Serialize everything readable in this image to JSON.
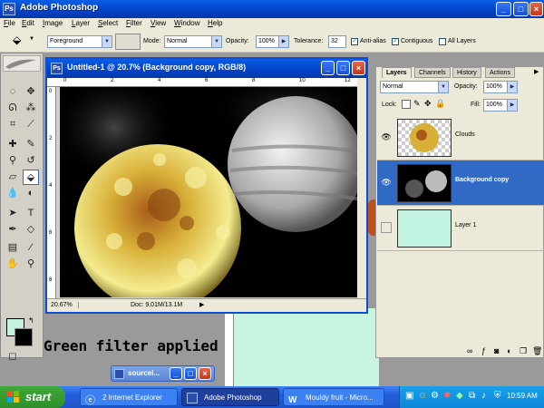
{
  "app": {
    "title": "Adobe Photoshop",
    "logo": "Ps"
  },
  "window_controls": {
    "minimize": "_",
    "maximize": "□",
    "close": "×"
  },
  "menu": [
    "File",
    "Edit",
    "Image",
    "Layer",
    "Select",
    "Filter",
    "View",
    "Window",
    "Help"
  ],
  "options": {
    "fill_source": "Foreground",
    "mode_label": "Mode:",
    "mode_value": "Normal",
    "opacity_label": "Opacity:",
    "opacity_value": "100%",
    "tolerance_label": "Tolerance:",
    "tolerance_value": "32",
    "antialias_label": "Anti-alias",
    "antialias_checked": true,
    "contiguous_label": "Contiguous",
    "contiguous_checked": true,
    "all_layers_label": "All Layers",
    "all_layers_checked": false
  },
  "document": {
    "title": "Untitled-1 @ 20.7% (Background copy, RGB/8)",
    "zoom": "20.67%",
    "doc_info": "Doc: 9.01M/13.1M",
    "ruler_top": [
      "0",
      "2",
      "4",
      "6",
      "8",
      "10",
      "12"
    ],
    "ruler_left": [
      "0",
      "2",
      "4",
      "6",
      "8"
    ]
  },
  "layers_panel": {
    "tabs": [
      "Layers",
      "Channels",
      "History",
      "Actions"
    ],
    "blend_mode": "Normal",
    "opacity_label": "Opacity:",
    "opacity_value": "100%",
    "lock_label": "Lock:",
    "fill_label": "Fill:",
    "fill_value": "100%",
    "layers": [
      {
        "name": "Clouds",
        "visible": true,
        "selected": false
      },
      {
        "name": "Background copy",
        "visible": true,
        "selected": true
      },
      {
        "name": "Layer 1",
        "visible": false,
        "selected": false
      }
    ]
  },
  "colors": {
    "foreground": "#c1f3e0",
    "background": "#000000",
    "accent": "#316ac5"
  },
  "caption": "Green filter applied",
  "minimized_window": {
    "title": "sourcei..."
  },
  "taskbar": {
    "start_label": "start",
    "tasks": [
      "2 Internet Explorer",
      "Adobe Photoshop",
      "Mouldy fruit - Micro..."
    ],
    "clock": "10:59 AM"
  }
}
